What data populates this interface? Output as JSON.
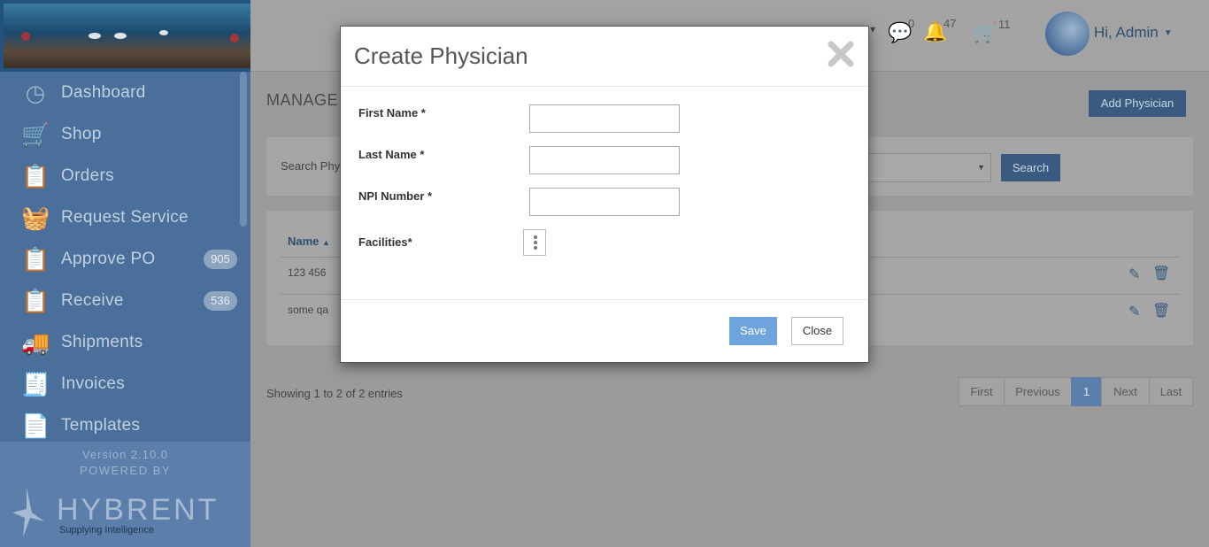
{
  "sidebar": {
    "items": [
      {
        "label": "Dashboard",
        "icon": "dashboard-gauge-icon",
        "badge": ""
      },
      {
        "label": "Shop",
        "icon": "cart-icon",
        "badge": ""
      },
      {
        "label": "Orders",
        "icon": "clipboard-search-icon",
        "badge": ""
      },
      {
        "label": "Request Service",
        "icon": "basket-icon",
        "badge": ""
      },
      {
        "label": "Approve PO",
        "icon": "clipboard-check-icon",
        "badge": "905"
      },
      {
        "label": "Receive",
        "icon": "clipboard-receive-icon",
        "badge": "536"
      },
      {
        "label": "Shipments",
        "icon": "truck-icon",
        "badge": ""
      },
      {
        "label": "Invoices",
        "icon": "invoice-icon",
        "badge": ""
      },
      {
        "label": "Templates",
        "icon": "template-icon",
        "badge": ""
      }
    ],
    "version": "Version 2.10.0",
    "powered_by": "POWERED BY",
    "brand": "HYBRENT",
    "tagline": "Supplying Intelligence"
  },
  "topbar": {
    "messages_count": "0",
    "notifications_count": "47",
    "cart_count": "11",
    "greeting": "Hi, Admin"
  },
  "page": {
    "title": "MANAGE",
    "add_button": "Add Physician",
    "search_label": "Search Phy",
    "search_button": "Search",
    "table": {
      "header_name": "Name",
      "rows": [
        "123 456",
        "some qa"
      ]
    },
    "showing": "Showing 1 to 2 of 2 entries",
    "pagination": {
      "first": "First",
      "previous": "Previous",
      "current": "1",
      "next": "Next",
      "last": "Last"
    }
  },
  "modal": {
    "title": "Create Physician",
    "fields": {
      "first_name": {
        "label": "First Name *",
        "value": ""
      },
      "last_name": {
        "label": "Last Name *",
        "value": ""
      },
      "npi": {
        "label": "NPI Number *",
        "value": ""
      },
      "facilities": {
        "label": "Facilities*"
      }
    },
    "save": "Save",
    "close": "Close"
  },
  "colors": {
    "accent": "#3a5a7f",
    "save_button": "#6fa5dc",
    "sidebar": "#4a6f9a"
  }
}
